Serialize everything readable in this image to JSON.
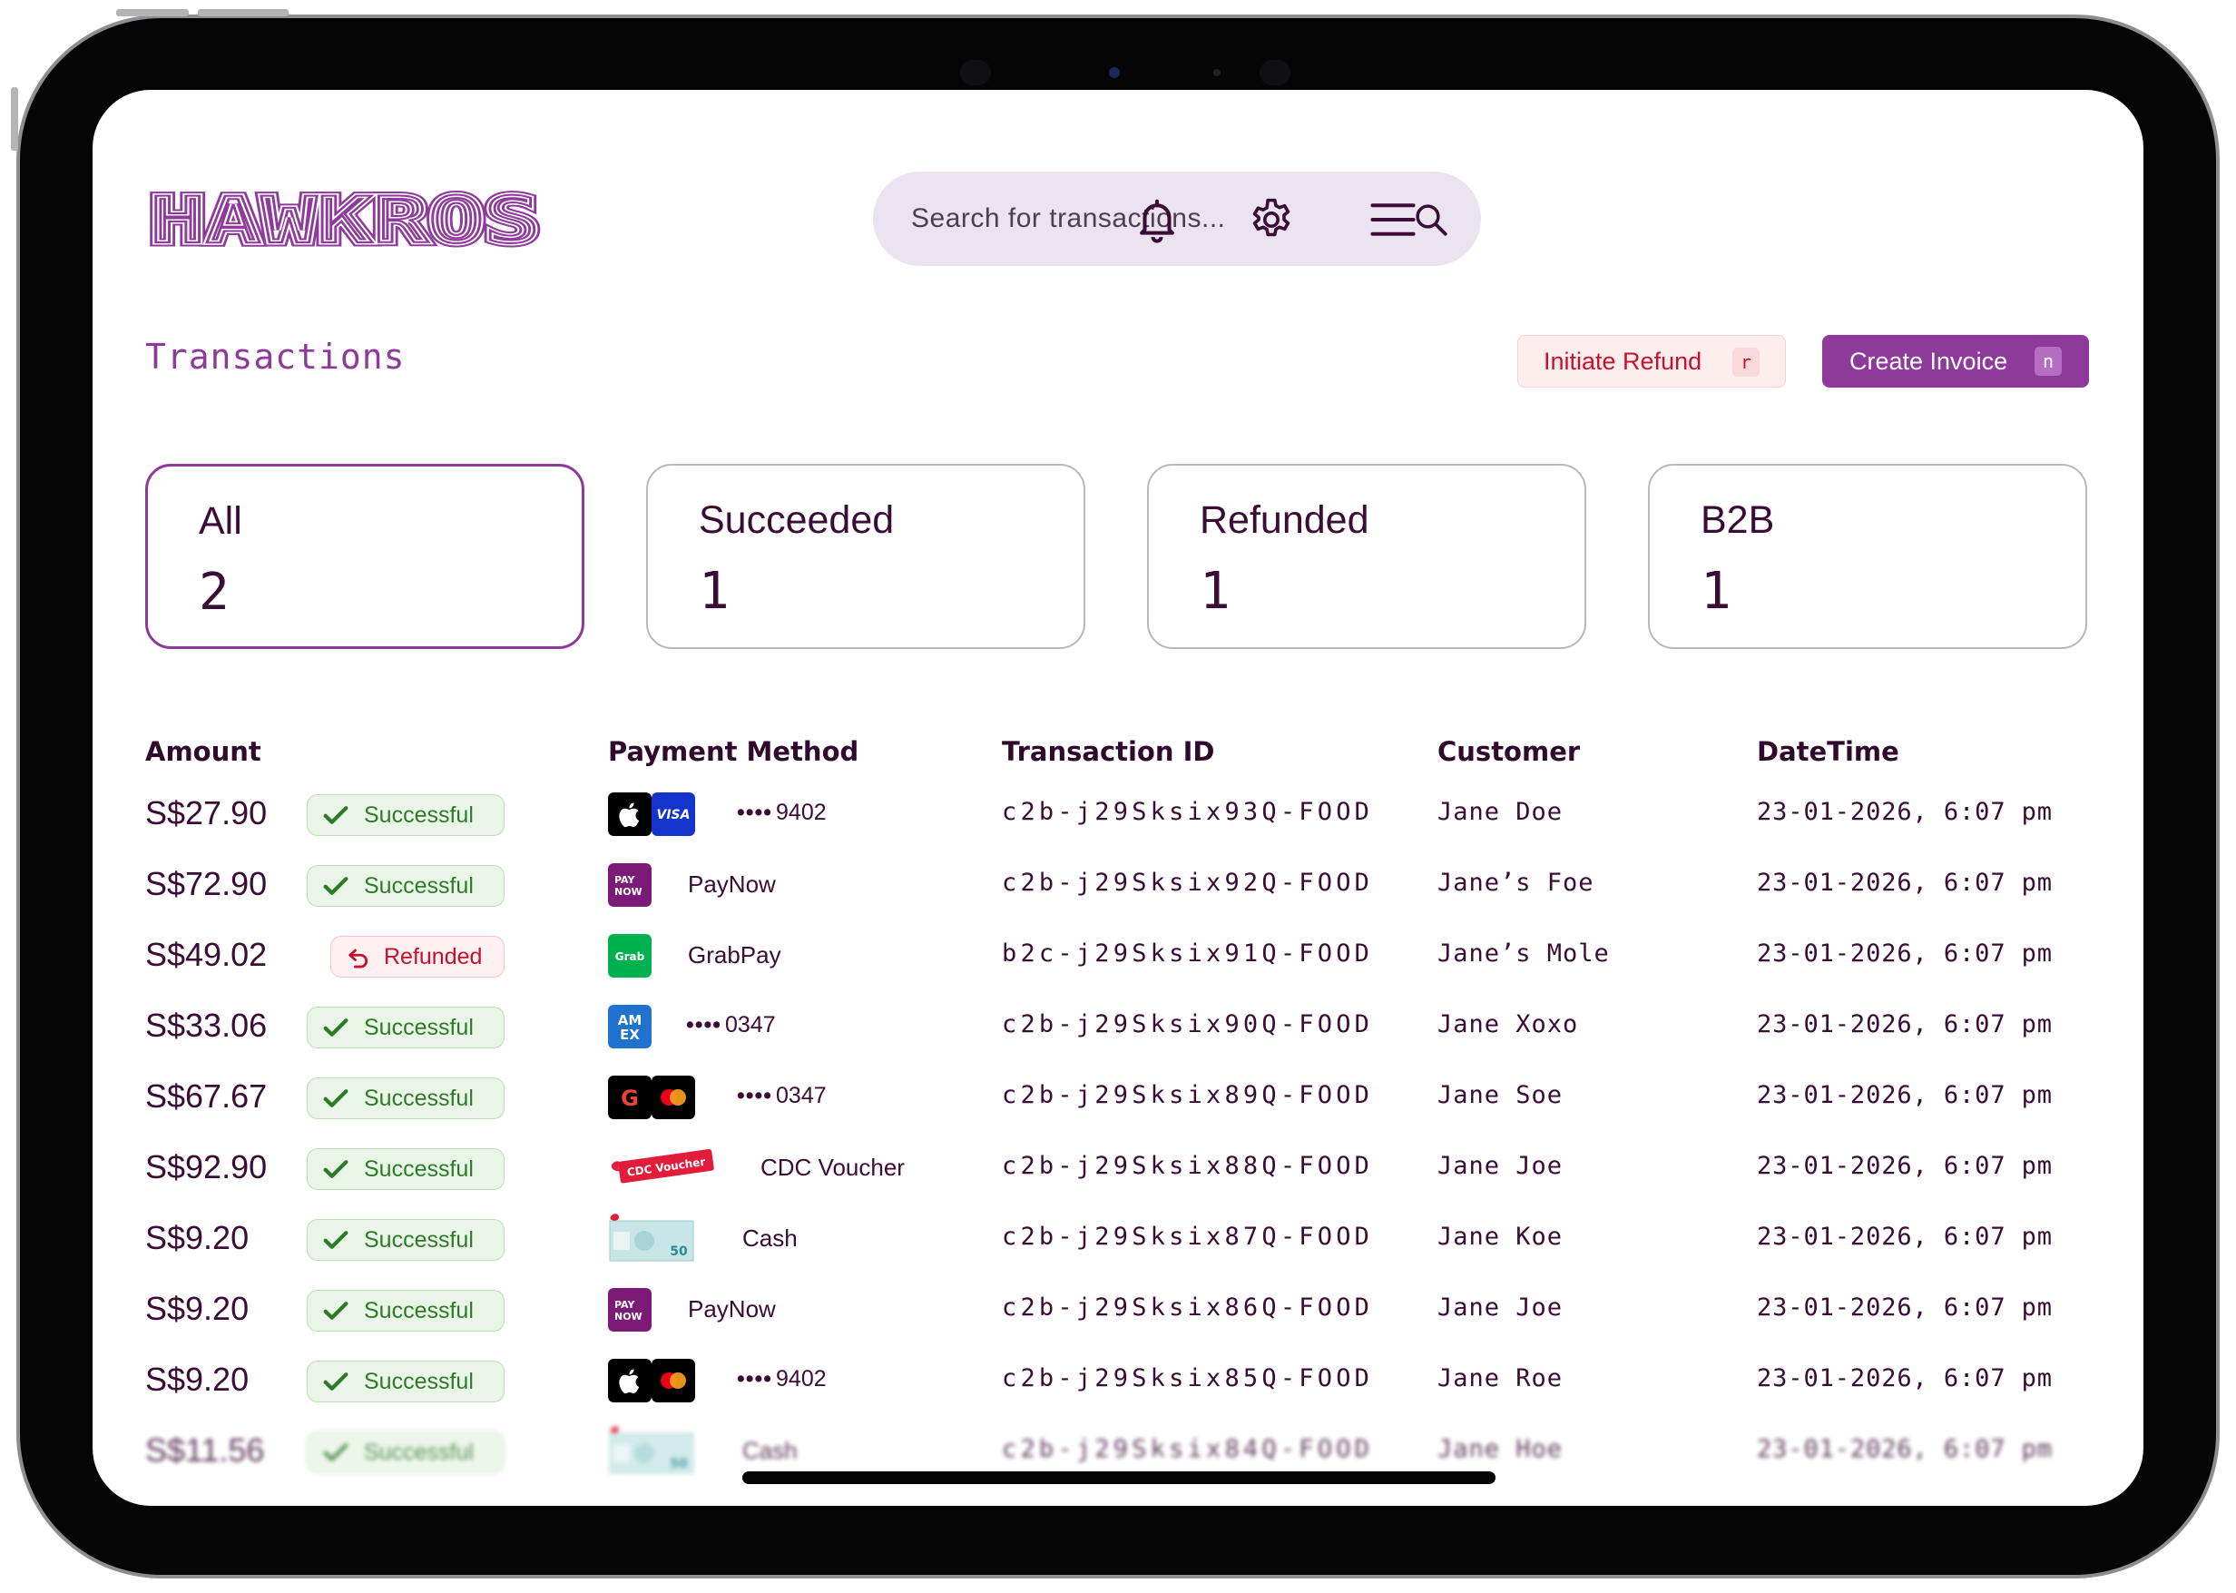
{
  "app": {
    "brand": "HAWKROS"
  },
  "search": {
    "placeholder": "Search for transactions..."
  },
  "header_icons": [
    "bell-icon",
    "gear-icon",
    "hamburger-menu-icon"
  ],
  "page": {
    "title": "Transactions"
  },
  "actions": {
    "refund": {
      "label": "Initiate Refund",
      "shortcut": "r"
    },
    "invoice": {
      "label": "Create Invoice",
      "shortcut": "n"
    }
  },
  "stats": [
    {
      "label": "All",
      "count": "2",
      "active": true
    },
    {
      "label": "Succeeded",
      "count": "1",
      "active": false
    },
    {
      "label": "Refunded",
      "count": "1",
      "active": false
    },
    {
      "label": "B2B",
      "count": "1",
      "active": false
    }
  ],
  "table": {
    "columns": [
      "Amount",
      "Payment Method",
      "Transaction ID",
      "Customer",
      "DateTime"
    ],
    "rows": [
      {
        "amount": "S$27.90",
        "status": "Successful",
        "method": {
          "icons": [
            "apple-pay-icon",
            "visa-icon"
          ],
          "masked": "••••",
          "last4": "9402"
        },
        "id": "c2b-j29Sksix93Q-FOOD",
        "customer": "Jane Doe",
        "datetime": "23-01-2026, 6:07 pm"
      },
      {
        "amount": "S$72.90",
        "status": "Successful",
        "method": {
          "icons": [
            "paynow-icon"
          ],
          "name": "PayNow"
        },
        "id": "c2b-j29Sksix92Q-FOOD",
        "customer": "Jane’s Foe",
        "datetime": "23-01-2026, 6:07 pm"
      },
      {
        "amount": "S$49.02",
        "status": "Refunded",
        "method": {
          "icons": [
            "grabpay-icon"
          ],
          "name": "GrabPay"
        },
        "id": "b2c-j29Sksix91Q-FOOD",
        "customer": "Jane’s Mole",
        "datetime": "23-01-2026, 6:07 pm"
      },
      {
        "amount": "S$33.06",
        "status": "Successful",
        "method": {
          "icons": [
            "amex-icon"
          ],
          "masked": "••••",
          "last4": "0347"
        },
        "id": "c2b-j29Sksix90Q-FOOD",
        "customer": "Jane Xoxo",
        "datetime": "23-01-2026, 6:07 pm"
      },
      {
        "amount": "S$67.67",
        "status": "Successful",
        "method": {
          "icons": [
            "google-pay-icon",
            "mastercard-icon"
          ],
          "masked": "••••",
          "last4": "0347"
        },
        "id": "c2b-j29Sksix89Q-FOOD",
        "customer": "Jane Soe",
        "datetime": "23-01-2026, 6:07 pm"
      },
      {
        "amount": "S$92.90",
        "status": "Successful",
        "method": {
          "icons": [
            "cdc-voucher-icon"
          ],
          "name": "CDC Voucher",
          "badge_text": "CDC Voucher"
        },
        "id": "c2b-j29Sksix88Q-FOOD",
        "customer": "Jane Joe",
        "datetime": "23-01-2026, 6:07 pm"
      },
      {
        "amount": "S$9.20",
        "status": "Successful",
        "method": {
          "icons": [
            "cash-icon"
          ],
          "name": "Cash",
          "note_text": "50"
        },
        "id": "c2b-j29Sksix87Q-FOOD",
        "customer": "Jane Koe",
        "datetime": "23-01-2026, 6:07 pm"
      },
      {
        "amount": "S$9.20",
        "status": "Successful",
        "method": {
          "icons": [
            "paynow-icon"
          ],
          "name": "PayNow"
        },
        "id": "c2b-j29Sksix86Q-FOOD",
        "customer": "Jane Joe",
        "datetime": "23-01-2026, 6:07 pm"
      },
      {
        "amount": "S$9.20",
        "status": "Successful",
        "method": {
          "icons": [
            "apple-pay-icon",
            "mastercard-icon"
          ],
          "masked": "••••",
          "last4": "9402"
        },
        "id": "c2b-j29Sksix85Q-FOOD",
        "customer": "Jane Roe",
        "datetime": "23-01-2026, 6:07 pm"
      },
      {
        "amount": "S$11.56",
        "status": "Successful",
        "method": {
          "icons": [
            "cash-icon"
          ],
          "name": "Cash",
          "note_text": "50"
        },
        "id": "c2b-j29Sksix84Q-FOOD",
        "customer": "Jane Hoe",
        "datetime": "23-01-2026, 6:07 pm"
      }
    ]
  },
  "icon_text": {
    "visa": "VISA",
    "paynow_top": "PAY",
    "paynow_bottom": "NOW",
    "grab": "Grab",
    "amex_top": "AM",
    "amex_bottom": "EX",
    "google": "G"
  },
  "colors": {
    "brand": "#8e3a9a",
    "success": "#2f7a28",
    "refund": "#c8102e",
    "search_bg": "#ebe3f0",
    "text": "#3a0c36"
  }
}
